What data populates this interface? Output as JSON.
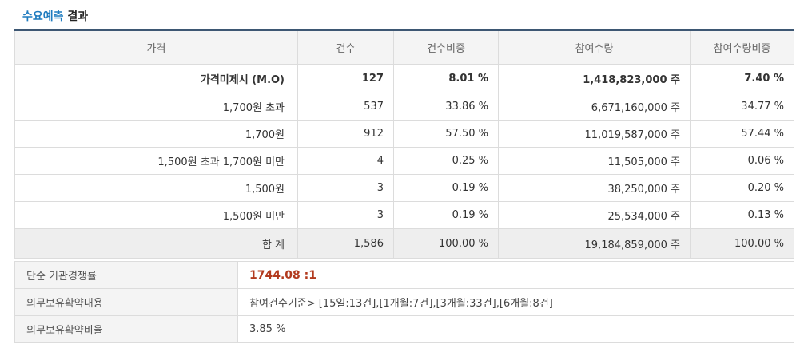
{
  "section_title": {
    "accent": "수요예측",
    "rest": " 결과"
  },
  "table": {
    "headers": [
      "가격",
      "건수",
      "건수비중",
      "참여수량",
      "참여수량비중"
    ],
    "rows": [
      {
        "price": "가격미제시 (M.O)",
        "count": "127",
        "count_ratio": "8.01 %",
        "quantity": "1,418,823,000 주",
        "quantity_ratio": "7.40 %"
      },
      {
        "price": "1,700원 초과",
        "count": "537",
        "count_ratio": "33.86 %",
        "quantity": "6,671,160,000 주",
        "quantity_ratio": "34.77 %"
      },
      {
        "price": "1,700원",
        "count": "912",
        "count_ratio": "57.50 %",
        "quantity": "11,019,587,000 주",
        "quantity_ratio": "57.44 %"
      },
      {
        "price": "1,500원 초과 1,700원 미만",
        "count": "4",
        "count_ratio": "0.25 %",
        "quantity": "11,505,000 주",
        "quantity_ratio": "0.06 %"
      },
      {
        "price": "1,500원",
        "count": "3",
        "count_ratio": "0.19 %",
        "quantity": "38,250,000 주",
        "quantity_ratio": "0.20 %"
      },
      {
        "price": "1,500원 미만",
        "count": "3",
        "count_ratio": "0.19 %",
        "quantity": "25,534,000 주",
        "quantity_ratio": "0.13 %"
      }
    ],
    "total": {
      "price": "합 계",
      "count": "1,586",
      "count_ratio": "100.00 %",
      "quantity": "19,184,859,000 주",
      "quantity_ratio": "100.00 %"
    }
  },
  "info": {
    "competition_label": "단순 기관경쟁률",
    "competition_value": "1744.08 :1",
    "lockup_label": "의무보유확약내용",
    "lockup_value": "참여건수기준> [15일:13건],[1개월:7건],[3개월:33건],[6개월:8건]",
    "lockup_ratio_label": "의무보유확약비율",
    "lockup_ratio_value": "3.85 %"
  }
}
